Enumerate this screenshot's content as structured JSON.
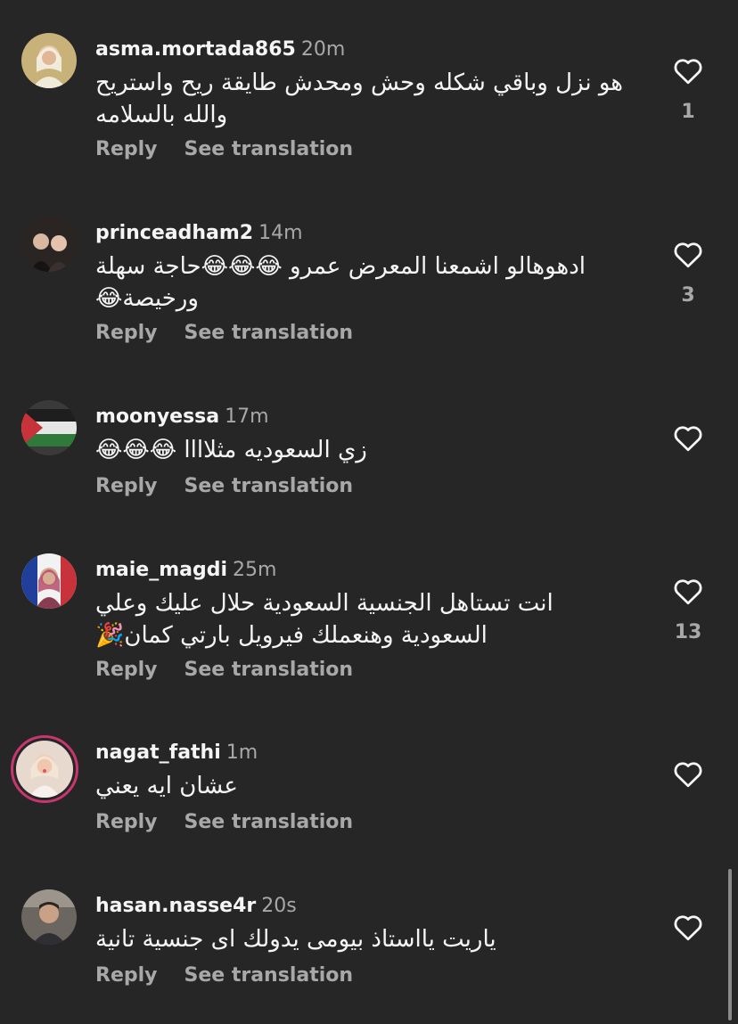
{
  "comments": [
    {
      "username": "asma.mortada865",
      "time": "20m",
      "text": "هو نزل وباقي شكله وحش ومحدش طايقة ريح واستريح والله  بالسلامه",
      "likes": "1",
      "reply": "Reply",
      "translate": "See translation"
    },
    {
      "username": "princeadham2",
      "time": "14m",
      "text": "ادهوهالو اشمعنا المعرض عمرو 😂😂😂حاجة سهلة ورخيصة😂",
      "likes": "3",
      "reply": "Reply",
      "translate": "See translation"
    },
    {
      "username": "moonyessa",
      "time": "17m",
      "text": "زي السعوديه مثلاااا 😂😂😂",
      "likes": "",
      "reply": "Reply",
      "translate": "See translation"
    },
    {
      "username": "maie_magdi",
      "time": "25m",
      "text": "انت تستاهل الجنسية السعودية حلال عليك وعلي السعودية وهنعملك فيرويل بارتي كمان🎉",
      "likes": "13",
      "reply": "Reply",
      "translate": "See translation"
    },
    {
      "username": "nagat_fathi",
      "time": "1m",
      "text": "عشان ايه يعني",
      "likes": "",
      "reply": "Reply",
      "translate": "See translation"
    },
    {
      "username": "hasan.nasse4r",
      "time": "20s",
      "text": "ياريت يااستاذ بيومى يدولك اى جنسية تانية",
      "likes": "",
      "reply": "Reply",
      "translate": "See translation"
    }
  ],
  "icons": {
    "like": "heart-outline-icon"
  }
}
